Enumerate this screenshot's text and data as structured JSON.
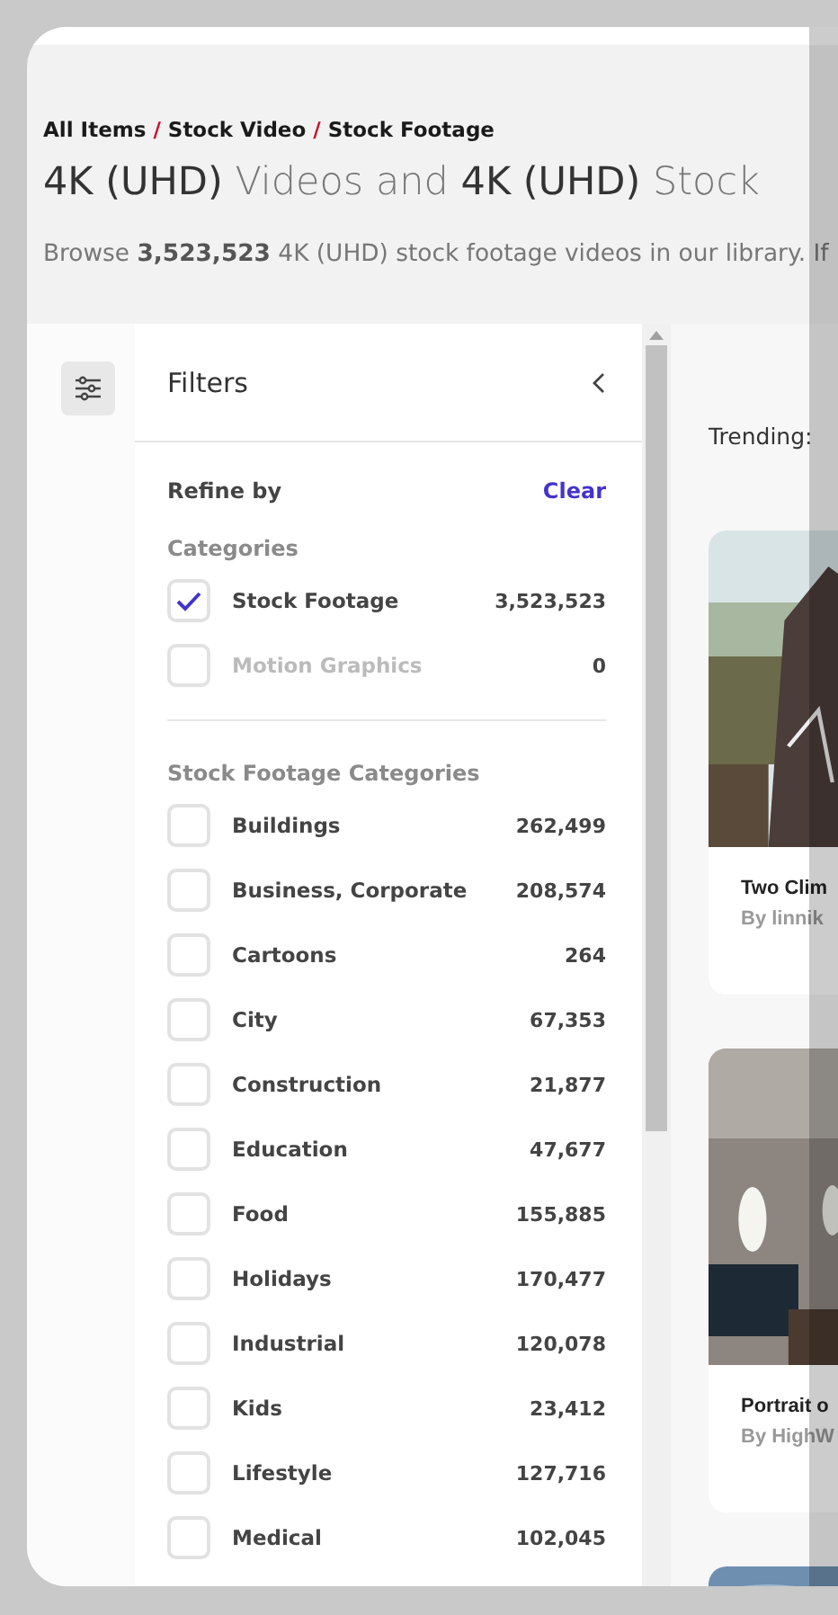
{
  "breadcrumb": {
    "separator": "/",
    "items": [
      "All Items",
      "Stock Video",
      "Stock Footage"
    ]
  },
  "heading": "**4K (UHD)** Videos and **4K (UHD)** Stock",
  "description": "Browse **3,523,523** 4K (UHD) stock footage videos in our library. If",
  "filters": {
    "title": "Filters",
    "refine_label": "Refine by",
    "clear": "Clear",
    "sections": [
      {
        "title": "Categories",
        "items": [
          {
            "label": "Stock Footage",
            "count": "3,523,523",
            "checked": true,
            "disabled": false
          },
          {
            "label": "Motion Graphics",
            "count": "0",
            "checked": false,
            "disabled": true
          }
        ]
      },
      {
        "title": "Stock Footage Categories",
        "items": [
          {
            "label": "Buildings",
            "count": "262,499",
            "checked": false,
            "disabled": false
          },
          {
            "label": "Business, Corporate",
            "count": "208,574",
            "checked": false,
            "disabled": false
          },
          {
            "label": "Cartoons",
            "count": "264",
            "checked": false,
            "disabled": false
          },
          {
            "label": "City",
            "count": "67,353",
            "checked": false,
            "disabled": false
          },
          {
            "label": "Construction",
            "count": "21,877",
            "checked": false,
            "disabled": false
          },
          {
            "label": "Education",
            "count": "47,677",
            "checked": false,
            "disabled": false
          },
          {
            "label": "Food",
            "count": "155,885",
            "checked": false,
            "disabled": false
          },
          {
            "label": "Holidays",
            "count": "170,477",
            "checked": false,
            "disabled": false
          },
          {
            "label": "Industrial",
            "count": "120,078",
            "checked": false,
            "disabled": false
          },
          {
            "label": "Kids",
            "count": "23,412",
            "checked": false,
            "disabled": false
          },
          {
            "label": "Lifestyle",
            "count": "127,716",
            "checked": false,
            "disabled": false
          },
          {
            "label": "Medical",
            "count": "102,045",
            "checked": false,
            "disabled": false
          }
        ]
      }
    ]
  },
  "trending_label": "Trending:",
  "videos": [
    {
      "title": "Two Clim",
      "author": "By linnik",
      "kind": "picture"
    },
    {
      "title": "Portrait o",
      "author": "By HighW",
      "kind": "picture"
    },
    {
      "kind": "picture"
    }
  ]
}
